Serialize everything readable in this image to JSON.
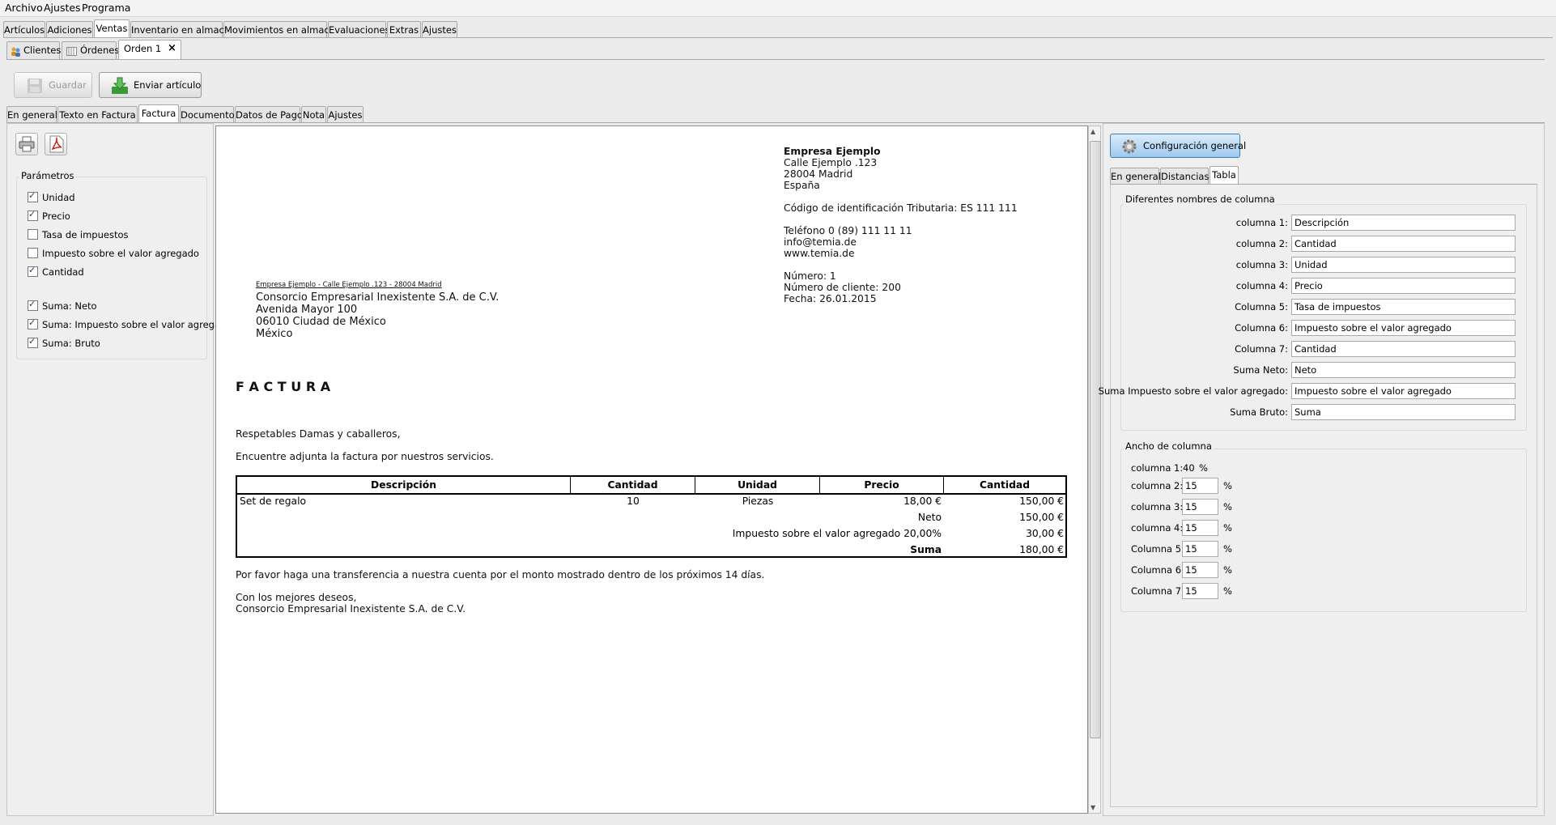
{
  "menubar": [
    "Archivo",
    "Ajustes",
    "Programa"
  ],
  "main_tabs": [
    "Artículos",
    "Adiciones",
    "Ventas",
    "Inventario en almacén",
    "Movimientos en almacén",
    "Evaluaciones",
    "Extras",
    "Ajustes"
  ],
  "sub_tabs": [
    {
      "label": "Clientes"
    },
    {
      "label": "Órdenes"
    },
    {
      "label": "Orden 1",
      "close": "×"
    }
  ],
  "toolbar": {
    "save": "Guardar",
    "send": "Enviar artículo"
  },
  "order_tabs": [
    "En general",
    "Texto en Factura",
    "Factura",
    "Documentos",
    "Datos de Pago",
    "Nota",
    "Ajustes"
  ],
  "params": {
    "title": "Parámetros",
    "items": [
      {
        "label": "Unidad",
        "checked": true
      },
      {
        "label": "Precio",
        "checked": true
      },
      {
        "label": "Tasa de impuestos",
        "checked": false
      },
      {
        "label": "Impuesto sobre el valor agregado",
        "checked": false
      },
      {
        "label": "Cantidad",
        "checked": true
      },
      {
        "label": "Suma: Neto",
        "checked": true
      },
      {
        "label": "Suma: Impuesto sobre el valor agregado",
        "checked": true
      },
      {
        "label": "Suma: Bruto",
        "checked": true
      }
    ]
  },
  "invoice": {
    "company_name": "Empresa Ejemplo",
    "company_lines": [
      "Calle Ejemplo .123",
      "28004 Madrid",
      "España"
    ],
    "tax_id": "Código de identificación Tributaria: ES 111 111",
    "contact_lines": [
      "Teléfono 0 (89) 111 11 11",
      "info@temia.de",
      "www.temia.de"
    ],
    "meta_lines": [
      "Número: 1",
      "Número de cliente: 200",
      "Fecha: 26.01.2015"
    ],
    "sender_line": "Empresa Ejemplo - Calle Ejemplo .123 - 28004 Madrid",
    "recipient_lines": [
      "Consorcio Empresarial Inexistente S.A. de C.V.",
      "Avenida Mayor 100",
      "06010 Ciudad de México",
      "México"
    ],
    "title": "F A C T U R A",
    "salutation": "Respetables Damas y caballeros,",
    "intro": "Encuentre adjunta la factura por nuestros servicios.",
    "table": {
      "headers": [
        "Descripción",
        "Cantidad",
        "Unidad",
        "Precio",
        "Cantidad"
      ],
      "rows": [
        [
          "Set de regalo",
          "10",
          "Piezas",
          "18,00 €",
          "150,00 €"
        ]
      ],
      "net_label": "Neto",
      "net_value": "150,00 €",
      "vat_label": "Impuesto sobre el valor agregado 20,00%",
      "vat_value": "30,00 €",
      "total_label": "Suma",
      "total_value": "180,00 €"
    },
    "payment_note": "Por favor haga una transferencia a nuestra cuenta por el monto mostrado dentro de los próximos 14 días.",
    "closing": "Con los mejores deseos,",
    "signature": "Consorcio Empresarial Inexistente S.A. de C.V."
  },
  "config": {
    "button": "Configuración general",
    "tabs": [
      "En general",
      "Distancias",
      "Tabla"
    ],
    "names_group": "Diferentes nombres de columna",
    "names": [
      {
        "label": "columna 1:",
        "value": "Descripción"
      },
      {
        "label": "columna 2:",
        "value": "Cantidad"
      },
      {
        "label": "columna 3:",
        "value": "Unidad"
      },
      {
        "label": "columna 4:",
        "value": "Precio"
      },
      {
        "label": "Columna 5:",
        "value": "Tasa de impuestos"
      },
      {
        "label": "Columna 6:",
        "value": "Impuesto sobre el valor agregado"
      },
      {
        "label": "Columna 7:",
        "value": "Cantidad"
      },
      {
        "label": "Suma Neto:",
        "value": "Neto"
      },
      {
        "label": "Suma Impuesto sobre el valor agregado:",
        "value": "Impuesto sobre el valor agregado"
      },
      {
        "label": "Suma Bruto:",
        "value": "Suma"
      }
    ],
    "width_group": "Ancho de columna",
    "width_first": {
      "label": "columna 1:",
      "value": "40",
      "unit": "%"
    },
    "widths": [
      {
        "label": "columna 2:",
        "value": "15",
        "unit": "%"
      },
      {
        "label": "columna 3:",
        "value": "15",
        "unit": "%"
      },
      {
        "label": "columna 4:",
        "value": "15",
        "unit": "%"
      },
      {
        "label": "Columna 5:",
        "value": "15",
        "unit": "%"
      },
      {
        "label": "Columna 6:",
        "value": "15",
        "unit": "%"
      },
      {
        "label": "Columna 7:",
        "value": "15",
        "unit": "%"
      }
    ]
  }
}
